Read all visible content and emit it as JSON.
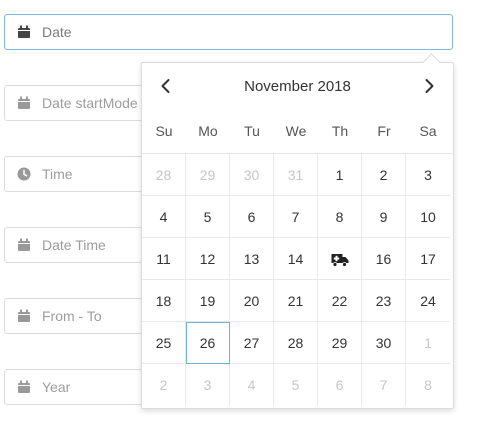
{
  "fields": [
    {
      "placeholder": "Date",
      "icon": "calendar-icon"
    },
    {
      "placeholder": "Date startMode",
      "icon": "calendar-icon"
    },
    {
      "placeholder": "Time",
      "icon": "clock-icon"
    },
    {
      "placeholder": "Date Time",
      "icon": "calendar-icon"
    },
    {
      "placeholder": "From - To",
      "icon": "calendar-icon"
    },
    {
      "placeholder": "Year",
      "icon": "calendar-icon"
    }
  ],
  "calendar": {
    "month_label": "November 2018",
    "weekdays": [
      "Su",
      "Mo",
      "Tu",
      "We",
      "Th",
      "Fr",
      "Sa"
    ],
    "weeks": [
      [
        {
          "t": "28",
          "m": true
        },
        {
          "t": "29",
          "m": true
        },
        {
          "t": "30",
          "m": true
        },
        {
          "t": "31",
          "m": true
        },
        {
          "t": "1"
        },
        {
          "t": "2"
        },
        {
          "t": "3"
        }
      ],
      [
        {
          "t": "4"
        },
        {
          "t": "5"
        },
        {
          "t": "6"
        },
        {
          "t": "7"
        },
        {
          "t": "8"
        },
        {
          "t": "9"
        },
        {
          "t": "10"
        }
      ],
      [
        {
          "t": "11"
        },
        {
          "t": "12"
        },
        {
          "t": "13"
        },
        {
          "t": "14"
        },
        {
          "t": "",
          "icon": "ambulance-icon"
        },
        {
          "t": "16"
        },
        {
          "t": "17"
        }
      ],
      [
        {
          "t": "18"
        },
        {
          "t": "19"
        },
        {
          "t": "20"
        },
        {
          "t": "21"
        },
        {
          "t": "22"
        },
        {
          "t": "23"
        },
        {
          "t": "24"
        }
      ],
      [
        {
          "t": "25"
        },
        {
          "t": "26",
          "today": true
        },
        {
          "t": "27"
        },
        {
          "t": "28"
        },
        {
          "t": "29"
        },
        {
          "t": "30"
        },
        {
          "t": "1",
          "m": true
        }
      ],
      [
        {
          "t": "2",
          "m": true
        },
        {
          "t": "3",
          "m": true
        },
        {
          "t": "4",
          "m": true
        },
        {
          "t": "5",
          "m": true
        },
        {
          "t": "6",
          "m": true
        },
        {
          "t": "7",
          "m": true
        },
        {
          "t": "8",
          "m": true
        }
      ]
    ]
  },
  "colors": {
    "accent": "#6fb3d6",
    "muted": "#c6c6c6",
    "icon": "#777777"
  }
}
